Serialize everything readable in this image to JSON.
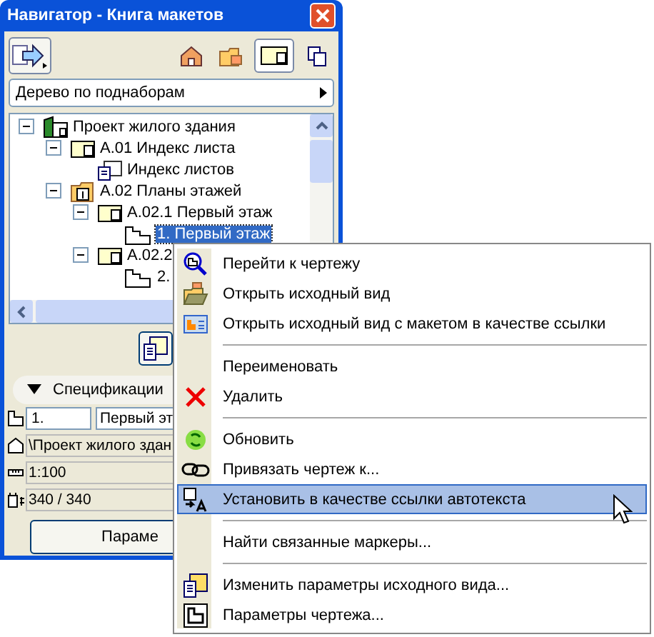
{
  "window": {
    "title": "Навигатор - Книга макетов"
  },
  "toolbar": [
    {
      "kind": "publish",
      "selected": false
    },
    {
      "kind": "project",
      "selected": false
    },
    {
      "kind": "views",
      "selected": false
    },
    {
      "kind": "layouts",
      "selected": true
    },
    {
      "kind": "publisher",
      "selected": false
    }
  ],
  "dropdown": {
    "value": "Дерево по поднаборам"
  },
  "tree": {
    "items": [
      {
        "label": "Проект жилого здания",
        "kind": "project",
        "expanded": true,
        "selected": false,
        "children": [
          {
            "label": "А.01  Индекс листа",
            "kind": "subset",
            "expanded": true,
            "selected": false,
            "children": [
              {
                "label": "Индекс листов",
                "kind": "layout",
                "selected": false
              }
            ]
          },
          {
            "label": "А.02 Планы этажей",
            "kind": "folder",
            "expanded": true,
            "selected": false,
            "children": [
              {
                "label": "А.02.1 Первый этаж",
                "kind": "subset",
                "expanded": true,
                "selected": false,
                "children": [
                  {
                    "label": "1. Первый этаж",
                    "kind": "drawing",
                    "selected": true
                  }
                ]
              },
              {
                "label": "А.02.2",
                "kind": "subset",
                "expanded": true,
                "selected": false,
                "children": [
                  {
                    "label": "2.",
                    "kind": "drawing",
                    "selected": false
                  }
                ]
              }
            ]
          }
        ]
      }
    ]
  },
  "specifications": {
    "title": "Спецификации",
    "expanded": true,
    "id_field": "1.",
    "name_field": "Первый эт",
    "path_field": "\\Проект жилого здан",
    "scale_field": "1:100",
    "size_field": "340 / 340"
  },
  "settings_button": "Параме",
  "context_menu": {
    "items": [
      {
        "kind": "goto",
        "label": "Перейти к чертежу",
        "selected": false
      },
      {
        "kind": "open",
        "label": "Открыть исходный вид",
        "selected": false
      },
      {
        "kind": "open_ref",
        "label": "Открыть исходный вид с макетом в качестве ссылки",
        "selected": false
      },
      {
        "kind": "separator"
      },
      {
        "kind": "plain",
        "label": "Переименовать",
        "selected": false
      },
      {
        "kind": "delete",
        "label": "Удалить",
        "selected": false
      },
      {
        "kind": "separator"
      },
      {
        "kind": "update",
        "label": "Обновить",
        "selected": false
      },
      {
        "kind": "link",
        "label": "Привязать чертеж к...",
        "selected": false
      },
      {
        "kind": "autotext",
        "label": "Установить в качестве ссылки автотекста",
        "selected": true
      },
      {
        "kind": "separator"
      },
      {
        "kind": "plain",
        "label": "Найти связанные маркеры...",
        "selected": false
      },
      {
        "kind": "separator"
      },
      {
        "kind": "edit",
        "label": "Изменить параметры исходного вида...",
        "selected": false
      },
      {
        "kind": "settings",
        "label": "Параметры чертежа...",
        "selected": false
      }
    ]
  }
}
